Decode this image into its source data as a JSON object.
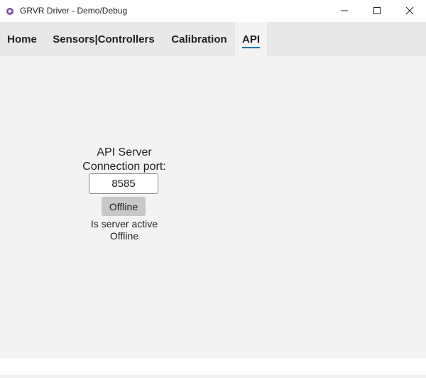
{
  "window": {
    "title": "GRVR Driver - Demo/Debug",
    "app_icon": "app-icon",
    "controls": {
      "minimize_icon": "minimize-icon",
      "maximize_icon": "maximize-icon",
      "close_icon": "close-icon"
    }
  },
  "tabs": [
    {
      "label": "Home",
      "selected": false
    },
    {
      "label": "Sensors|Controllers",
      "selected": false
    },
    {
      "label": "Calibration",
      "selected": false
    },
    {
      "label": "API",
      "selected": true
    }
  ],
  "api": {
    "title": "API Server",
    "port_label": "Connection port:",
    "port_value": "8585",
    "status_button_label": "Offline",
    "active_label": "Is server active",
    "active_value": "Offline"
  },
  "colors": {
    "tab_underline": "#1a73b6",
    "tabbar_bg": "#e8e8e8",
    "content_bg": "#f3f3f3"
  }
}
